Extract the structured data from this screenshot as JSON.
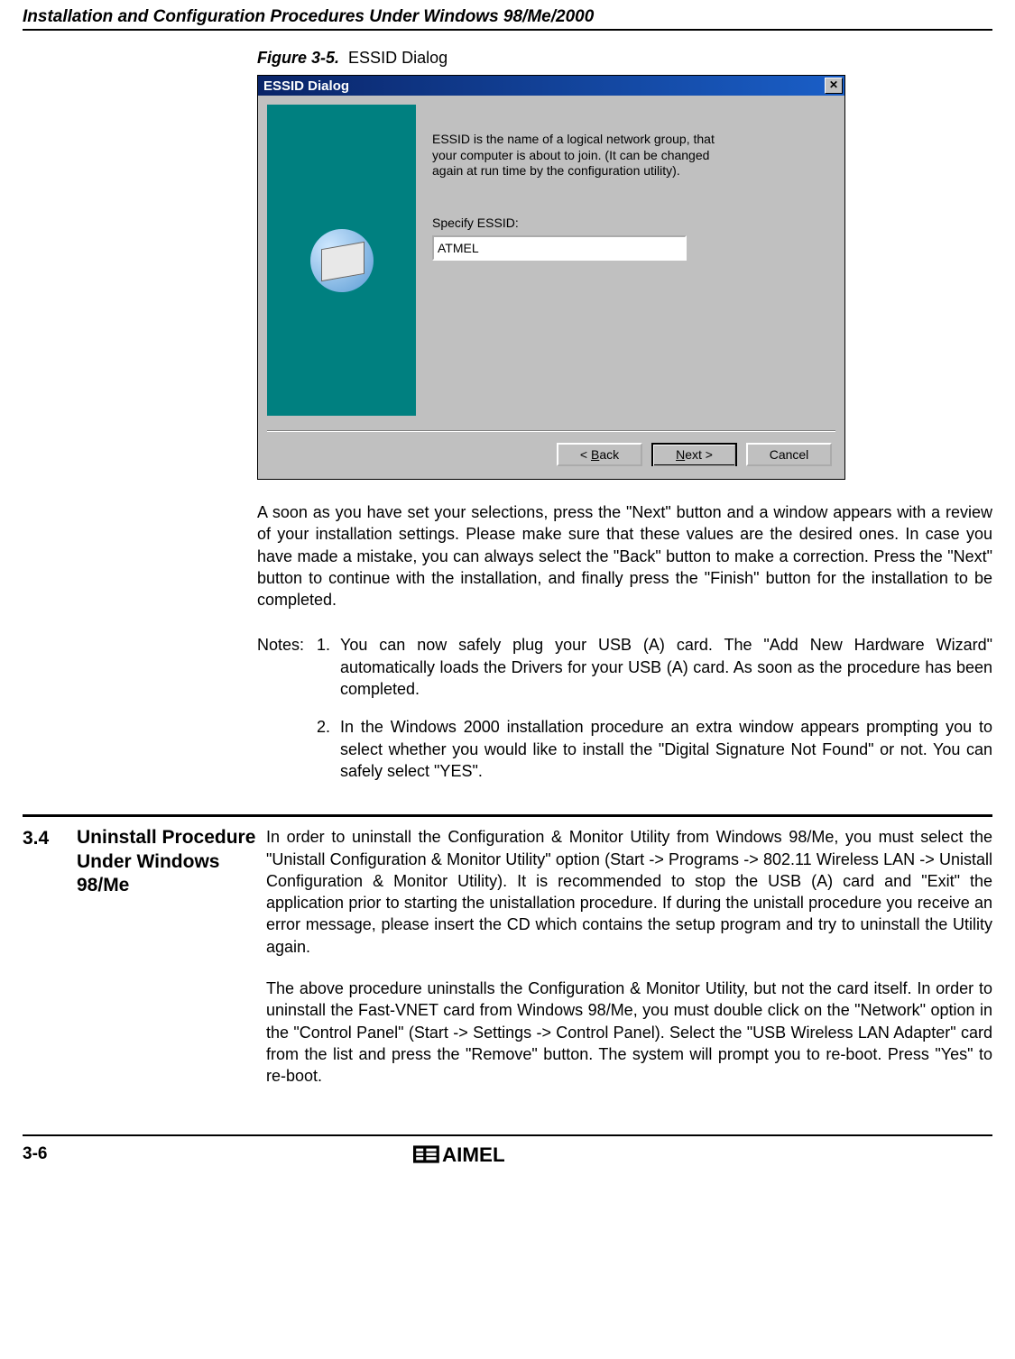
{
  "header": {
    "running_title": "Installation and Configuration Procedures Under Windows 98/Me/2000"
  },
  "figure": {
    "label": "Figure 3-5.",
    "caption": "ESSID Dialog"
  },
  "dialog": {
    "title": "ESSID Dialog",
    "close_glyph": "✕",
    "description": "ESSID is the name of a logical network group, that your computer is about to join. (It can be changed again at run time by the configuration utility).",
    "field_label": "Specify ESSID:",
    "field_value": "ATMEL",
    "buttons": {
      "back_prefix": "< ",
      "back_u": "B",
      "back_rest": "ack",
      "next_u": "N",
      "next_rest": "ext >",
      "cancel": "Cancel"
    }
  },
  "para_after_figure": "A soon as you have set your selections, press the \"Next\" button and a window appears with a review of your installation settings. Please make sure that these values are the desired ones. In case you have made a mistake, you can always select the \"Back\" button to make a correction. Press the \"Next\" button to continue with the installation, and finally press the \"Finish\" button for the installation to be completed.",
  "notes": {
    "label": "Notes:",
    "items": [
      {
        "num": "1.",
        "text": "You can now safely plug your USB (A) card. The \"Add New Hardware Wizard\" automatically loads the Drivers for your USB (A) card. As soon as the procedure has been completed."
      },
      {
        "num": "2.",
        "text": "In the Windows 2000 installation procedure an extra window appears prompting you to select whether you would like to install the \"Digital Signature Not Found\" or not. You can safely select \"YES\"."
      }
    ]
  },
  "section": {
    "number": "3.4",
    "title": "Uninstall Procedure Under Windows 98/Me",
    "paragraphs": [
      "In order to uninstall the Configuration & Monitor Utility from Windows 98/Me, you must select the \"Unistall Configuration & Monitor Utility\" option (Start -> Programs -> 802.11 Wireless LAN -> Unistall Configuration & Monitor Utility). It is recommended to stop the USB (A) card and \"Exit\" the application prior to starting the unistallation procedure. If during the unistall procedure you receive an error message, please insert the CD which contains the setup program and try to uninstall the Utility again.",
      "The above procedure uninstalls the Configuration & Monitor Utility, but not the card itself. In order to uninstall the Fast-VNET card from Windows 98/Me, you must double click on the \"Network\" option in the \"Control Panel\" (Start -> Settings -> Control Panel). Select the \"USB Wireless LAN Adapter\" card from the list and press the \"Remove\" button. The system will prompt you to re-boot. Press \"Yes\" to re-boot."
    ]
  },
  "footer": {
    "page_number": "3-6",
    "logo_text": "ATMEL"
  }
}
